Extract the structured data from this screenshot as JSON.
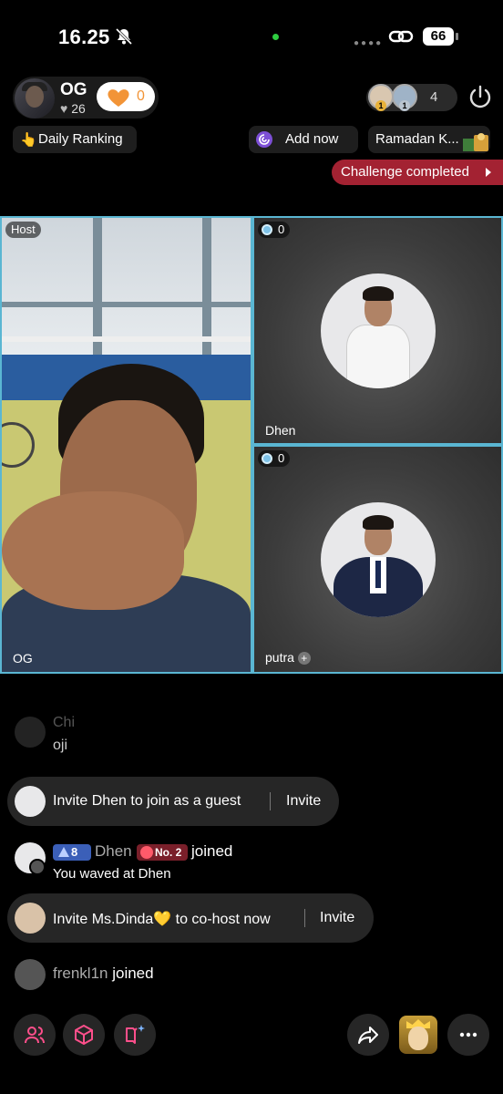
{
  "status_bar": {
    "time": "16.25",
    "battery": "66",
    "icons": [
      "bell-slash-icon",
      "camera-dot-icon",
      "link-icon",
      "battery-icon"
    ]
  },
  "host": {
    "name": "OG",
    "likes": "26",
    "like_button_count": "0"
  },
  "viewers": {
    "count": "4",
    "ranks": [
      "1",
      "1"
    ]
  },
  "chips": {
    "daily_ranking": "Daily Ranking",
    "add_now": "Add now",
    "ramadan": "Ramadan K..."
  },
  "challenge": {
    "label": "Challenge completed"
  },
  "tiles": {
    "host": {
      "tag": "Host",
      "name": "OG"
    },
    "guest1": {
      "gems": "0",
      "name": "Dhen"
    },
    "guest2": {
      "gems": "0",
      "name": "putra"
    }
  },
  "chat": {
    "faded_name": "Chi",
    "faded_msg": "oji",
    "invite1": {
      "text": "Invite Dhen to join as a guest",
      "button": "Invite"
    },
    "dhen_join": {
      "level": "8",
      "name": "Dhen",
      "badge": "No. 2",
      "joined": "joined",
      "waved": "You waved at Dhen"
    },
    "invite2": {
      "text": "Invite Ms.Dinda💛 to co-host now",
      "button": "Invite"
    },
    "frenk_join": {
      "name": "frenkl1n",
      "joined": "joined"
    }
  },
  "bottom_bar": {
    "buttons": [
      "people-icon",
      "box-icon",
      "sparkle-book-icon",
      "share-icon",
      "gift-icon",
      "more-icon"
    ]
  },
  "colors": {
    "accent_blue": "#5ab6d2",
    "challenge_red": "#a32232",
    "like_orange": "#f29437",
    "level_blue": "#3b5fb8"
  }
}
